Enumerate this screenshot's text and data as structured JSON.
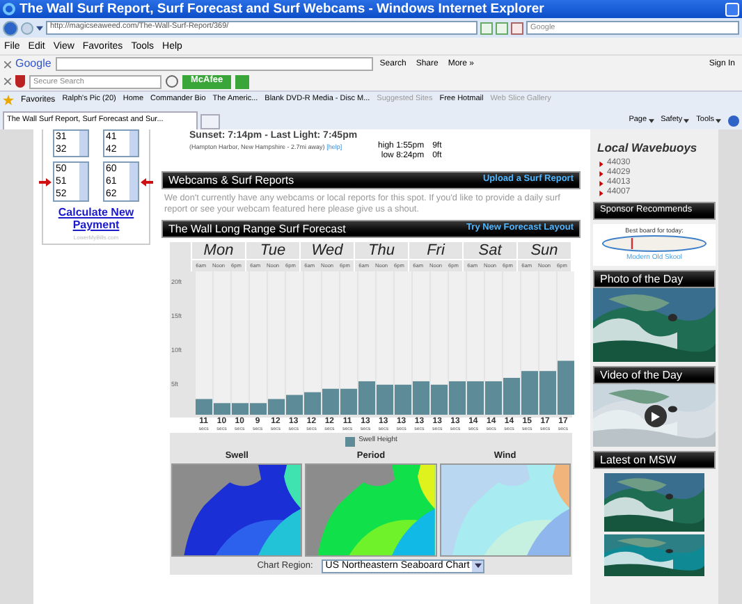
{
  "window": {
    "title": "The Wall Surf Report, Surf Forecast and Surf Webcams - Windows Internet Explorer"
  },
  "address_bar": {
    "url": "http://magicseaweed.com/The-Wall-Surf-Report/369/"
  },
  "search_box": {
    "placeholder": "Google"
  },
  "menu": [
    "File",
    "Edit",
    "View",
    "Favorites",
    "Tools",
    "Help"
  ],
  "google_toolbar": {
    "logo": "Google",
    "search": "Search",
    "share": "Share",
    "more": "More »",
    "sign_in": "Sign In"
  },
  "mcafee_toolbar": {
    "placeholder": "Secure Search",
    "brand": "McAfee"
  },
  "favorites_bar": {
    "label": "Favorites",
    "items": [
      {
        "label": "Ralph's Pic (20)",
        "disabled": false
      },
      {
        "label": "Home",
        "disabled": false
      },
      {
        "label": "Commander Bio",
        "disabled": false
      },
      {
        "label": "The Americ...",
        "disabled": false
      },
      {
        "label": "Blank DVD-R Media - Disc M...",
        "disabled": false
      },
      {
        "label": "Suggested Sites",
        "disabled": true
      },
      {
        "label": "Free Hotmail",
        "disabled": false
      },
      {
        "label": "Web Slice Gallery",
        "disabled": true
      }
    ]
  },
  "tab": {
    "title": "The Wall Surf Report, Surf Forecast and Sur..."
  },
  "command_bar": [
    "Page",
    "Safety",
    "Tools"
  ],
  "ad": {
    "lists": [
      [
        "31",
        "32"
      ],
      [
        "41",
        "42"
      ],
      [
        "50",
        "51",
        "52"
      ],
      [
        "60",
        "61",
        "62"
      ]
    ],
    "link": "Calculate New Payment",
    "footer": "LowerMyBills.com"
  },
  "spot_info": {
    "sunset": "Sunset: 7:14pm - Last Light: 7:45pm",
    "location": "(Hampton Harbor, New Hampshire - 2.7mi away)",
    "help": "[help]",
    "tides": [
      {
        "type": "high",
        "time": "1:55pm",
        "height": "9ft"
      },
      {
        "type": "low",
        "time": "8:24pm",
        "height": "0ft"
      }
    ]
  },
  "webcams": {
    "title": "Webcams & Surf Reports",
    "link": "Upload a Surf Report",
    "text": "We don't currently have any webcams or local reports for this spot. If you'd like to provide a daily surf report or see your webcam featured here please give us a shout."
  },
  "forecast": {
    "title": "The Wall Long Range Surf Forecast",
    "link": "Try New Forecast Layout",
    "days": [
      {
        "name": "Mon",
        "times": [
          "6am",
          "Noon",
          "6pm"
        ]
      },
      {
        "name": "Tue",
        "times": [
          "6am",
          "Noon",
          "6pm"
        ]
      },
      {
        "name": "Wed",
        "times": [
          "6am",
          "Noon",
          "6pm"
        ]
      },
      {
        "name": "Thu",
        "times": [
          "6am",
          "Noon",
          "6pm"
        ]
      },
      {
        "name": "Fri",
        "times": [
          "6am",
          "Noon",
          "6pm"
        ]
      },
      {
        "name": "Sat",
        "times": [
          "6am",
          "Noon",
          "6pm"
        ]
      },
      {
        "name": "Sun",
        "times": [
          "6am",
          "Noon",
          "6pm"
        ]
      }
    ],
    "periods": [
      {
        "value": "11",
        "unit": "secs"
      },
      {
        "value": "10",
        "unit": "secs"
      },
      {
        "value": "10",
        "unit": "secs"
      },
      {
        "value": "9",
        "unit": "secs"
      },
      {
        "value": "12",
        "unit": "secs"
      },
      {
        "value": "13",
        "unit": "secs"
      },
      {
        "value": "12",
        "unit": "secs"
      },
      {
        "value": "12",
        "unit": "secs"
      },
      {
        "value": "11",
        "unit": "secs"
      },
      {
        "value": "13",
        "unit": "secs"
      },
      {
        "value": "13",
        "unit": "secs"
      },
      {
        "value": "13",
        "unit": "secs"
      },
      {
        "value": "13",
        "unit": "secs"
      },
      {
        "value": "13",
        "unit": "secs"
      },
      {
        "value": "13",
        "unit": "secs"
      },
      {
        "value": "14",
        "unit": "secs"
      },
      {
        "value": "14",
        "unit": "secs"
      },
      {
        "value": "14",
        "unit": "secs"
      },
      {
        "value": "15",
        "unit": "secs"
      },
      {
        "value": "17",
        "unit": "secs"
      },
      {
        "value": "17",
        "unit": "secs"
      }
    ],
    "chart_data": {
      "type": "bar",
      "ylim": [
        0,
        21
      ],
      "yticks": [
        {
          "value": 20,
          "label": "20ft"
        },
        {
          "value": 15,
          "label": "15ft"
        },
        {
          "value": 10,
          "label": "10ft"
        },
        {
          "value": 5,
          "label": "5ft"
        }
      ],
      "series": [
        {
          "name": "Swell Height",
          "color": "#5e8b98",
          "values": [
            2.3,
            1.7,
            1.7,
            1.7,
            2.3,
            2.9,
            3.3,
            3.8,
            3.8,
            4.9,
            4.4,
            4.4,
            4.9,
            4.4,
            4.9,
            4.9,
            4.9,
            5.4,
            6.4,
            6.4,
            7.9
          ]
        }
      ]
    },
    "maps": [
      {
        "title": "Swell",
        "kind": "swell"
      },
      {
        "title": "Period",
        "kind": "period"
      },
      {
        "title": "Wind",
        "kind": "wind"
      }
    ],
    "region_label": "Chart Region:",
    "region_value": "US Northeastern Seaboard Chart"
  },
  "sidebar": {
    "buoys_title": "Local Wavebuoys",
    "buoys": [
      "44030",
      "44029",
      "44013",
      "44007"
    ],
    "sponsor_title": "Sponsor Recommends",
    "sponsor_caption": "Best board for today:",
    "sponsor_link": "Modern Old Skool",
    "photo_title": "Photo of the Day",
    "video_title": "Video of the Day",
    "latest_title": "Latest on MSW"
  }
}
